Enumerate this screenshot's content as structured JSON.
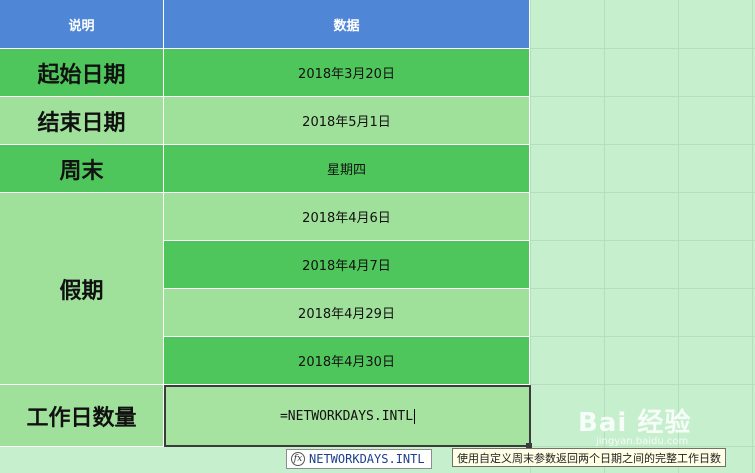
{
  "header": {
    "col_a": "说明",
    "col_b": "数据"
  },
  "rows": [
    {
      "label": "起始日期",
      "value": "2018年3月20日"
    },
    {
      "label": "结束日期",
      "value": "2018年5月1日"
    },
    {
      "label": "周末",
      "value": "星期四"
    },
    {
      "label": "假期",
      "values": [
        "2018年4月6日",
        "2018年4月7日",
        "2018年4月29日",
        "2018年4月30日"
      ]
    },
    {
      "label": "工作日数量",
      "formula": "=NETWORKDAYS.INTL"
    }
  ],
  "autocomplete": {
    "icon": "function-icon",
    "function_name": "NETWORKDAYS.INTL",
    "description": "使用自定义周末参数返回两个日期之间的完整工作日数"
  },
  "watermark": {
    "main": "Bai 经验",
    "sub": "jingyan.baidu.com"
  },
  "colors": {
    "header": "#4f86d6",
    "dark_green": "#4fc65b",
    "light_green": "#9fe09a",
    "background": "#c6efce"
  }
}
